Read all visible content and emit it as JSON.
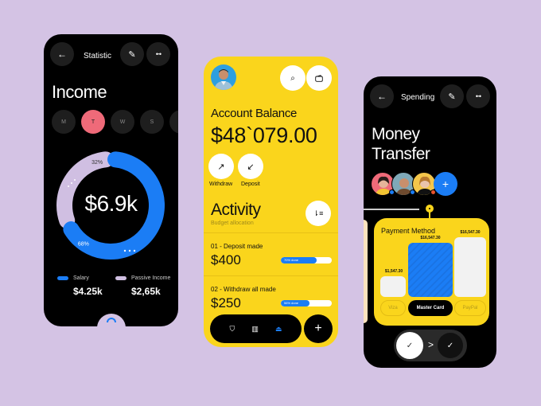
{
  "colors": {
    "background": "#d4c3e4",
    "accent_blue": "#1b7df5",
    "accent_yellow": "#fad51c",
    "accent_pink": "#ef6a79",
    "lavender": "#d0bfe2"
  },
  "statistic_screen": {
    "header": {
      "back_icon": "arrow-left-icon",
      "title": "Statistic",
      "edit_icon": "pencil-icon",
      "more_icon": "dots-icon"
    },
    "title": "Income",
    "days": [
      {
        "label": "M",
        "active": false
      },
      {
        "label": "T",
        "active": true
      },
      {
        "label": "W",
        "active": false
      },
      {
        "label": "S",
        "active": false
      }
    ],
    "donut": {
      "total": "$6.9k",
      "segments": [
        {
          "name": "Salary",
          "percent": 68,
          "label": "68%",
          "color": "#1b7df5"
        },
        {
          "name": "Passive Income",
          "percent": 32,
          "label": "32%",
          "color": "#d0bfe2"
        }
      ]
    },
    "legend": [
      {
        "label": "Salary",
        "value": "$4.25k",
        "color": "#1b7df5"
      },
      {
        "label": "Passive Income",
        "value": "$2,65k",
        "color": "#d0bfe2"
      }
    ]
  },
  "account_screen": {
    "search_icon": "search-icon",
    "wallet_icon": "wallet-icon",
    "balance_label": "Account Balance",
    "balance": "$48`079.00",
    "actions": [
      {
        "label": "Withdraw",
        "icon": "arrow-up-right-icon"
      },
      {
        "label": "Deposit",
        "icon": "arrow-down-left-icon"
      }
    ],
    "activity_title": "Activity",
    "activity_subtitle": "Budget allocation",
    "sort_icon": "sort-icon",
    "items": [
      {
        "label": "01 - Deposit made",
        "amount": "$400",
        "progress_label": "70% done",
        "progress": 70
      },
      {
        "label": "02 - Withdraw all made",
        "amount": "$250",
        "progress_label": "56% done",
        "progress": 56
      }
    ],
    "tabbar": [
      {
        "icon": "shield-icon",
        "active": false
      },
      {
        "icon": "chart-icon",
        "active": false
      },
      {
        "icon": "bank-icon",
        "active": true
      }
    ],
    "add_label": "+"
  },
  "spending_screen": {
    "header": {
      "back_icon": "arrow-left-icon",
      "title": "Spending",
      "edit_icon": "pencil-icon",
      "more_icon": "dots-icon"
    },
    "title_line1": "Money",
    "title_line2": "Transfer",
    "contacts": [
      {
        "bg": "#ef6a79",
        "status": "#1b7df5"
      },
      {
        "bg": "#7fa9b8",
        "status": "#1b7df5"
      },
      {
        "bg": "#f4c64a",
        "status": "#e8532c"
      }
    ],
    "add_contact_label": "+",
    "payment": {
      "title": "Payment Method",
      "methods": [
        {
          "label": "Viza",
          "amount": "$1,547.30",
          "selected": false,
          "share": 0.35
        },
        {
          "label": "Master Card",
          "amount": "$16,547.30",
          "selected": true,
          "share": 0.9
        },
        {
          "label": "PayPal",
          "amount": "$16,547.30",
          "selected": false,
          "share": 1.0
        }
      ]
    },
    "confirm": {
      "check_icon": "check-icon",
      "arrow": ">",
      "check2_icon": "check-icon"
    }
  }
}
